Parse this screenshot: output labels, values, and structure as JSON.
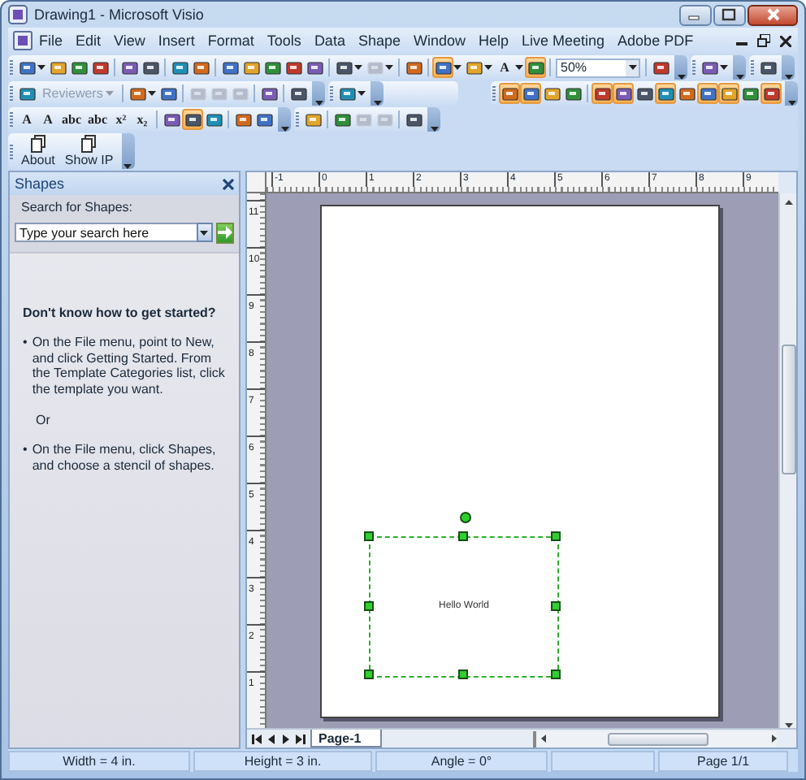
{
  "window": {
    "title": "Drawing1 - Microsoft Visio"
  },
  "menu": [
    "File",
    "Edit",
    "View",
    "Insert",
    "Format",
    "Tools",
    "Data",
    "Shape",
    "Window",
    "Help",
    "Live Meeting",
    "Adobe PDF"
  ],
  "toolbars": [
    [
      {
        "items": [
          {
            "kind": "button",
            "pressed": false,
            "disabled": false
          },
          {
            "kind": "caret"
          },
          {
            "kind": "button",
            "pressed": false,
            "disabled": false
          },
          {
            "kind": "button",
            "pressed": false,
            "disabled": false
          },
          {
            "kind": "button",
            "pressed": false,
            "disabled": false
          },
          {
            "kind": "sep"
          },
          {
            "kind": "button",
            "pressed": false,
            "disabled": false
          },
          {
            "kind": "button",
            "pressed": false,
            "disabled": false
          },
          {
            "kind": "sep"
          },
          {
            "kind": "button",
            "pressed": false,
            "disabled": false
          },
          {
            "kind": "button",
            "pressed": false,
            "disabled": false
          },
          {
            "kind": "sep"
          },
          {
            "kind": "button",
            "pressed": false,
            "disabled": false
          },
          {
            "kind": "button",
            "pressed": false,
            "disabled": false
          },
          {
            "kind": "button",
            "pressed": false,
            "disabled": false
          },
          {
            "kind": "button",
            "pressed": false,
            "disabled": false
          },
          {
            "kind": "button",
            "pressed": false,
            "disabled": false
          },
          {
            "kind": "sep"
          },
          {
            "kind": "button",
            "pressed": false,
            "disabled": false
          },
          {
            "kind": "caret"
          },
          {
            "kind": "button",
            "pressed": false,
            "disabled": true
          },
          {
            "kind": "caret"
          },
          {
            "kind": "sep"
          },
          {
            "kind": "button",
            "pressed": false,
            "disabled": false
          },
          {
            "kind": "sep"
          },
          {
            "kind": "button",
            "pressed": true,
            "disabled": false
          },
          {
            "kind": "caret"
          },
          {
            "kind": "button",
            "pressed": false,
            "disabled": false
          },
          {
            "kind": "caret"
          },
          {
            "kind": "glyph",
            "label": "A",
            "pressed": false
          },
          {
            "kind": "caret"
          },
          {
            "kind": "button",
            "pressed": true,
            "disabled": false
          },
          {
            "kind": "sep"
          },
          {
            "kind": "combo",
            "value": "50%"
          },
          {
            "kind": "sep"
          },
          {
            "kind": "button",
            "pressed": false,
            "disabled": false
          }
        ]
      },
      {
        "items": [
          {
            "kind": "button",
            "pressed": false,
            "disabled": false
          },
          {
            "kind": "caret"
          }
        ]
      },
      {
        "items": [
          {
            "kind": "button",
            "pressed": false,
            "disabled": false
          }
        ]
      }
    ],
    [
      {
        "items": [
          {
            "kind": "button",
            "pressed": false,
            "disabled": false
          },
          {
            "kind": "menu",
            "label": "Reviewers",
            "disabled": true
          },
          {
            "kind": "sep"
          },
          {
            "kind": "button",
            "pressed": false,
            "disabled": false
          },
          {
            "kind": "caret"
          },
          {
            "kind": "button",
            "pressed": false,
            "disabled": false
          },
          {
            "kind": "sep"
          },
          {
            "kind": "button",
            "pressed": false,
            "disabled": true
          },
          {
            "kind": "button",
            "pressed": false,
            "disabled": true
          },
          {
            "kind": "button",
            "pressed": false,
            "disabled": true
          },
          {
            "kind": "sep"
          },
          {
            "kind": "button",
            "pressed": false,
            "disabled": false
          },
          {
            "kind": "sep"
          },
          {
            "kind": "button",
            "pressed": false,
            "disabled": false
          }
        ]
      },
      {
        "items": [
          {
            "kind": "button",
            "pressed": false,
            "disabled": false
          },
          {
            "kind": "caret"
          }
        ]
      },
      {
        "items": [
          {
            "kind": "button",
            "pressed": true,
            "disabled": false
          },
          {
            "kind": "button",
            "pressed": true,
            "disabled": false
          },
          {
            "kind": "button",
            "pressed": false,
            "disabled": false
          },
          {
            "kind": "button",
            "pressed": false,
            "disabled": false
          },
          {
            "kind": "sep"
          },
          {
            "kind": "button",
            "pressed": true,
            "disabled": false
          },
          {
            "kind": "button",
            "pressed": true,
            "disabled": false
          },
          {
            "kind": "button",
            "pressed": false,
            "disabled": false
          },
          {
            "kind": "button",
            "pressed": true,
            "disabled": false
          },
          {
            "kind": "button",
            "pressed": false,
            "disabled": false
          },
          {
            "kind": "button",
            "pressed": true,
            "disabled": false
          },
          {
            "kind": "button",
            "pressed": true,
            "disabled": false
          },
          {
            "kind": "button",
            "pressed": false,
            "disabled": false
          },
          {
            "kind": "button",
            "pressed": true,
            "disabled": false
          }
        ]
      }
    ],
    [
      {
        "items": [
          {
            "kind": "glyph",
            "label": "A",
            "pressed": false
          },
          {
            "kind": "glyph",
            "label": "A",
            "pressed": false
          },
          {
            "kind": "glyph",
            "label": "abc",
            "pressed": false
          },
          {
            "kind": "glyph",
            "label": "abc",
            "pressed": false
          },
          {
            "kind": "glyph",
            "label": "x²",
            "pressed": false
          },
          {
            "kind": "glyph",
            "label": "x₂",
            "pressed": false
          },
          {
            "kind": "sep"
          },
          {
            "kind": "button",
            "pressed": false,
            "disabled": false
          },
          {
            "kind": "button",
            "pressed": true,
            "disabled": false
          },
          {
            "kind": "button",
            "pressed": false,
            "disabled": false
          },
          {
            "kind": "sep"
          },
          {
            "kind": "button",
            "pressed": false,
            "disabled": false
          },
          {
            "kind": "button",
            "pressed": false,
            "disabled": false
          }
        ]
      },
      {
        "items": [
          {
            "kind": "button",
            "pressed": false,
            "disabled": false
          },
          {
            "kind": "sep"
          },
          {
            "kind": "button",
            "pressed": false,
            "disabled": false
          },
          {
            "kind": "button",
            "pressed": false,
            "disabled": true
          },
          {
            "kind": "button",
            "pressed": false,
            "disabled": true
          },
          {
            "kind": "sep"
          },
          {
            "kind": "button",
            "pressed": false,
            "disabled": false
          }
        ]
      }
    ],
    [
      {
        "items": [
          {
            "kind": "big",
            "label": "About"
          },
          {
            "kind": "big",
            "label": "Show IP"
          }
        ]
      }
    ]
  ],
  "shapes_pane": {
    "title": "Shapes",
    "search_label": "Search for Shapes:",
    "search": {
      "placeholder": "Type your search here"
    },
    "heading": "Don't know how to get started?",
    "paragraphs": [
      {
        "bullet": "•",
        "text": "On the File menu, point to New, and click Getting Started. From the Template Categories list, click the template you want."
      },
      {
        "text": "Or"
      },
      {
        "bullet": "•",
        "text": "On the File menu, click Shapes, and choose a stencil of shapes."
      }
    ]
  },
  "rulers": {
    "horizontal": [
      "-1",
      "0",
      "1",
      "2",
      "3",
      "4",
      "5",
      "6",
      "7",
      "8",
      "9"
    ],
    "vertical": [
      "11",
      "10",
      "9",
      "8",
      "7",
      "6",
      "5",
      "4",
      "3",
      "2",
      "1"
    ]
  },
  "shape": {
    "text": "Hello World",
    "selected": true
  },
  "page_tabs": [
    {
      "label": "Page-1",
      "selected": true
    }
  ],
  "status_bar": [
    "Width = 4 in.",
    "Height = 3 in.",
    "Angle = 0°",
    "Page 1/1"
  ]
}
